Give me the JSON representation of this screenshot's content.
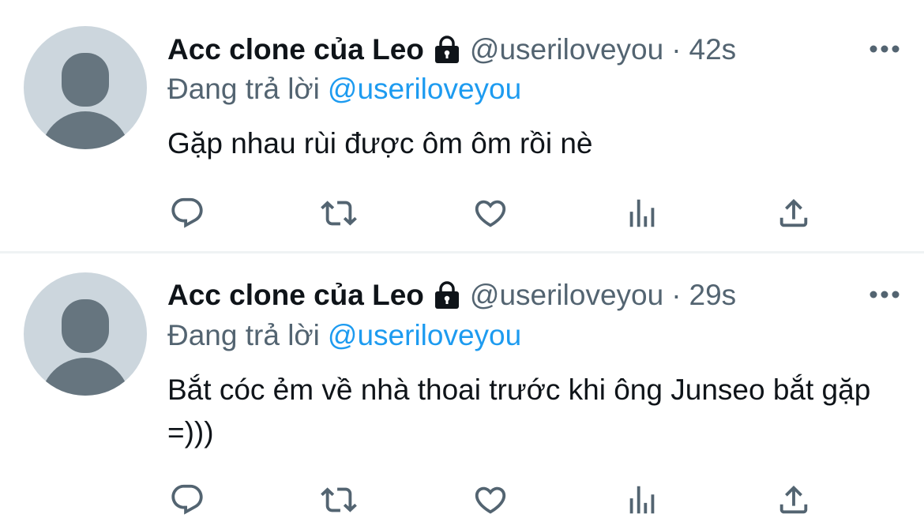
{
  "colors": {
    "text_primary": "#0f1419",
    "text_secondary": "#536471",
    "accent": "#1d9bf0",
    "avatar_bg": "#ccd6dd",
    "avatar_fg": "#66757f",
    "separator": "#eff3f4"
  },
  "tweets": [
    {
      "display_name": "Acc clone của Leo",
      "handle": "@useriloveyou",
      "separator": "·",
      "time": "42s",
      "reply_prefix": "Đang trả lời",
      "reply_to": "@useriloveyou",
      "text": "Gặp nhau rùi được ôm ôm rồi nè",
      "icons": [
        "lock-icon",
        "more-icon",
        "reply-icon",
        "retweet-icon",
        "like-icon",
        "views-icon",
        "share-icon"
      ]
    },
    {
      "display_name": "Acc clone của Leo",
      "handle": "@useriloveyou",
      "separator": "·",
      "time": "29s",
      "reply_prefix": "Đang trả lời",
      "reply_to": "@useriloveyou",
      "text": "Bắt cóc ẻm về nhà thoai trước khi ông Junseo bắt gặp =)))",
      "icons": [
        "lock-icon",
        "more-icon",
        "reply-icon",
        "retweet-icon",
        "like-icon",
        "views-icon",
        "share-icon"
      ]
    }
  ]
}
